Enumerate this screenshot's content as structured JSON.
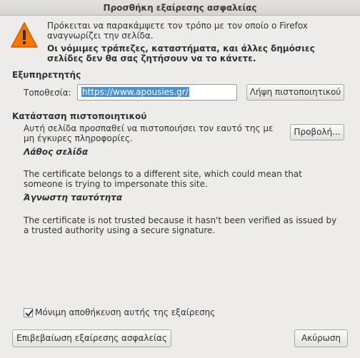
{
  "window": {
    "title": "Προσθήκη εξαίρεσης ασφαλείας"
  },
  "intro": {
    "line1": "Πρόκειται να παρακάμψετε τον τρόπο με τον οποίο ο Firefox",
    "line2": "αναγνωρίζει την σελίδα.",
    "bold1": "Οι νόμιμες τράπεζες, καταστήματα, και άλλες δημόσιες",
    "bold2": "σελίδες δεν θα σας ζητήσουν να το κάνετε."
  },
  "server": {
    "heading": "Εξυπηρετητής",
    "location_label": "Τοποθεσία:",
    "location_value": "https://www.apousies.gr/",
    "get_cert_button": "Λήψη πιστοποιητικού"
  },
  "cert_status": {
    "heading": "Κατάσταση πιστοποιητικού",
    "desc1": "Αυτή σελίδα προσπαθεί να πιστοποιήσει τον εαυτό της με",
    "desc2": "μη έγκυρες πληροφορίες.",
    "view_button": "Προβολή...",
    "wrong_site_title": "Λάθος σελίδα",
    "wrong_site_text1": "The certificate belongs to a different site, which could mean that",
    "wrong_site_text2": "someone is trying to impersonate this site.",
    "unknown_identity_title": "Άγνωστη ταυτότητα",
    "unknown_identity_text1": "The certificate is not trusted because it hasn't been verified as issued by",
    "unknown_identity_text2": "a trusted authority using a secure signature."
  },
  "permanent": {
    "label": "Μόνιμη αποθήκευση αυτής της εξαίρεσης",
    "checked": true
  },
  "footer": {
    "confirm_button": "Επιβεβαίωση εξαίρεσης ασφαλείας",
    "cancel_button": "Ακύρωση"
  },
  "icons": {
    "warning": "warning-triangle-icon",
    "checkbox": "checkmark-icon"
  },
  "colors": {
    "warning": "#f57900",
    "selection": "#4a90d9"
  }
}
